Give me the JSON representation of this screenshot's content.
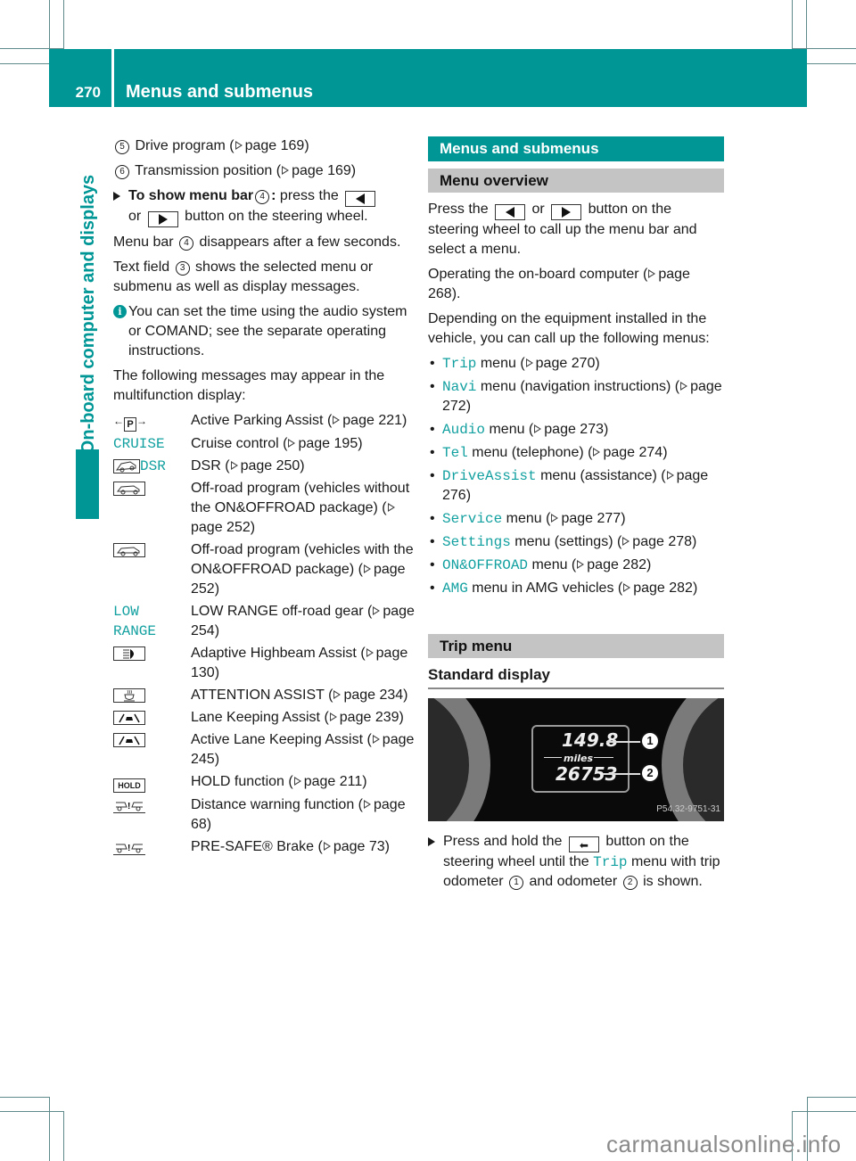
{
  "header": {
    "page_number": "270",
    "title": "Menus and submenus"
  },
  "sidebar": {
    "chapter": "On-board computer and displays"
  },
  "left": {
    "items_top": [
      {
        "num": "5",
        "text": "Drive program (",
        "ref": "page 169",
        "close": ")"
      },
      {
        "num": "6",
        "text": "Transmission position (",
        "ref": "page 169",
        "close": ")"
      }
    ],
    "step1": {
      "bold": "To show menu bar",
      "num": "4",
      "colon": ":",
      "t1": " press the ",
      "or": " or ",
      "t2": " button on the steering wheel."
    },
    "para1": {
      "t1": "Menu bar ",
      "num": "4",
      "t2": " disappears after a few seconds."
    },
    "para2": {
      "t1": "Text field ",
      "num": "3",
      "t2": " shows the selected menu or submenu as well as display messages."
    },
    "info": "You can set the time using the audio system or COMAND; see the separate operating instructions.",
    "para3": "The following messages may appear in the multifunction display:",
    "messages": [
      {
        "symbol": "parking-assist",
        "desc": "Active Parking Assist",
        "ref": "page 221"
      },
      {
        "symbol_text": "CRUISE",
        "desc": "Cruise control",
        "ref": "page 195"
      },
      {
        "symbol_text": "DSR",
        "desc": "DSR",
        "ref": "page 250"
      },
      {
        "symbol": "offroad",
        "desc": "Off-road program (vehicles without the ON&OFFROAD package)",
        "ref": "page 252"
      },
      {
        "symbol": "offroad2",
        "desc": "Off-road program (vehicles with the ON&OFFROAD package)",
        "ref": "page 252"
      },
      {
        "symbol_text": "LOW RANGE",
        "desc": "LOW RANGE off-road gear",
        "ref": "page 254"
      },
      {
        "symbol": "highbeam",
        "desc": "Adaptive Highbeam Assist",
        "ref": "page 130"
      },
      {
        "symbol": "attention",
        "desc": "ATTENTION ASSIST",
        "ref": "page 234"
      },
      {
        "symbol": "lane",
        "desc": "Lane Keeping Assist",
        "ref": "page 239"
      },
      {
        "symbol": "lane2",
        "desc": "Active Lane Keeping Assist",
        "ref": "page 245"
      },
      {
        "symbol_text": "HOLD",
        "desc": "HOLD function",
        "ref": "page 211"
      },
      {
        "symbol": "distance",
        "desc": "Distance warning function",
        "ref": "page 68"
      },
      {
        "symbol": "presafe",
        "desc": "PRE-SAFE® Brake",
        "ref": "page 73"
      }
    ]
  },
  "right": {
    "section_title": "Menus and submenus",
    "subsection_title": "Menu overview",
    "para1": {
      "t1": "Press the ",
      "or": " or ",
      "t2": " button on the steering wheel to call up the menu bar and select a menu."
    },
    "para2": {
      "t1": "Operating the on-board computer (",
      "ref": "page 268",
      "close": ")."
    },
    "para3": "Depending on the equipment installed in the vehicle, you can call up the following menus:",
    "menus": [
      {
        "name": "Trip",
        "text": " menu (",
        "ref": "page 270",
        "close": ")"
      },
      {
        "name": "Navi",
        "text": " menu (navigation instructions) (",
        "ref": "page 272",
        "close": ")"
      },
      {
        "name": "Audio",
        "text": " menu (",
        "ref": "page 273",
        "close": ")"
      },
      {
        "name": "Tel",
        "text": " menu (telephone) (",
        "ref": "page 274",
        "close": ")"
      },
      {
        "name": "DriveAssist",
        "text": " menu (assistance) (",
        "ref": "page 276",
        "close": ")"
      },
      {
        "name": "Service",
        "text": " menu (",
        "ref": "page 277",
        "close": ")"
      },
      {
        "name": "Settings",
        "text": " menu (settings) (",
        "ref": "page 278",
        "close": ")"
      },
      {
        "name": "ON&OFFROAD",
        "text": " menu (",
        "ref": "page 282",
        "close": ")"
      },
      {
        "name": "AMG",
        "text": " menu in AMG vehicles (",
        "ref": "page 282",
        "close": ")"
      }
    ],
    "trip_title": "Trip menu",
    "standard_display": "Standard display",
    "photo": {
      "trip_value": "149.8",
      "unit": "miles",
      "odometer_value": "26753",
      "callout1": "1",
      "callout2": "2",
      "photo_id": "P54.32-9751-31"
    },
    "step": {
      "t1": "Press and hold the ",
      "t2": " button on the steering wheel until the ",
      "menu": "Trip",
      "t3": " menu with trip odometer ",
      "n1": "1",
      "t4": " and odometer ",
      "n2": "2",
      "t5": " is shown."
    }
  },
  "footer": {
    "watermark": "carmanualsonline.info"
  },
  "colors": {
    "accent": "#009696",
    "menu_text": "#13a0a0",
    "grey_bar": "#c4c4c4"
  }
}
